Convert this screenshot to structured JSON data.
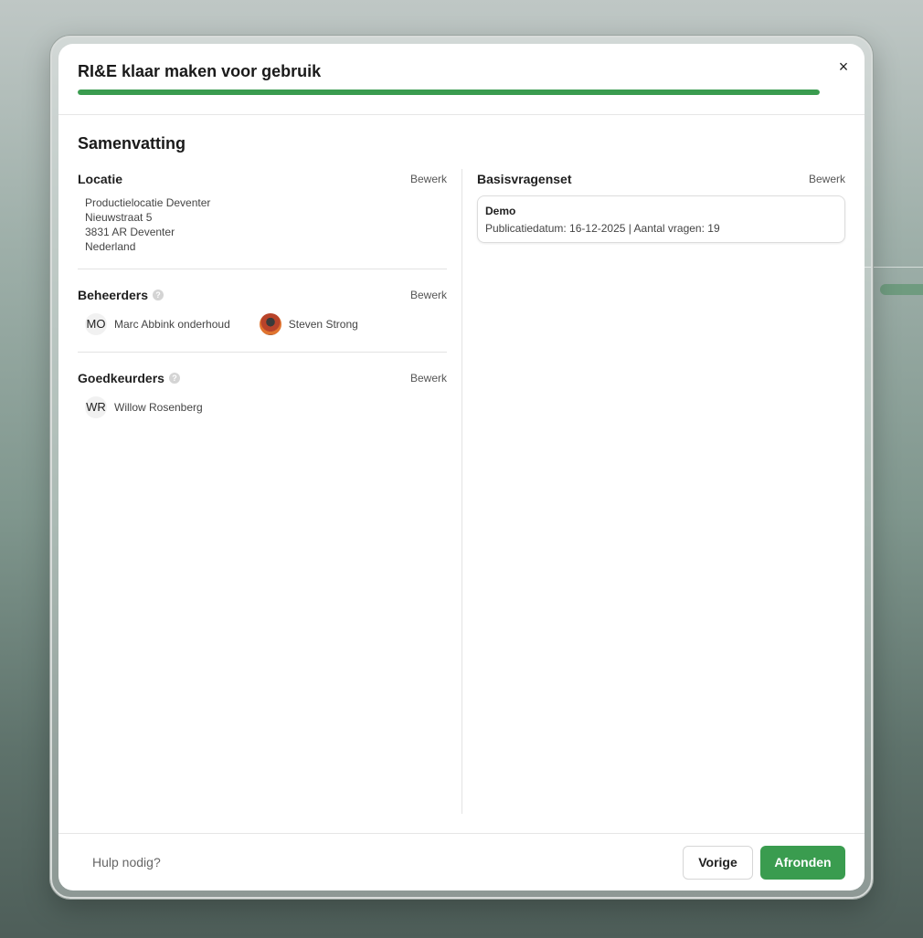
{
  "dialog": {
    "title": "RI&E klaar maken voor gebruik",
    "close_symbol": "×",
    "progress_percent": 100
  },
  "summary": {
    "heading": "Samenvatting",
    "edit_label": "Bewerk",
    "location": {
      "title": "Locatie",
      "lines": [
        "Productielocatie Deventer",
        "Nieuwstraat 5",
        "3831 AR Deventer",
        "Nederland"
      ]
    },
    "managers": {
      "title": "Beheerders",
      "help_symbol": "?",
      "people": [
        {
          "initials": "MO",
          "name": "Marc Abbink onderhoud"
        },
        {
          "initials": "",
          "name": "Steven Strong"
        }
      ]
    },
    "approvers": {
      "title": "Goedkeurders",
      "help_symbol": "?",
      "people": [
        {
          "initials": "WR",
          "name": "Willow Rosenberg"
        }
      ]
    },
    "question_set": {
      "title": "Basisvragenset",
      "card_title": "Demo",
      "card_meta": "Publicatiedatum: 16-12-2025 | Aantal vragen: 19"
    }
  },
  "footer": {
    "help_label": "Hulp nodig?",
    "prev_label": "Vorige",
    "finish_label": "Afronden"
  },
  "colors": {
    "accent": "#3a9c4f"
  }
}
